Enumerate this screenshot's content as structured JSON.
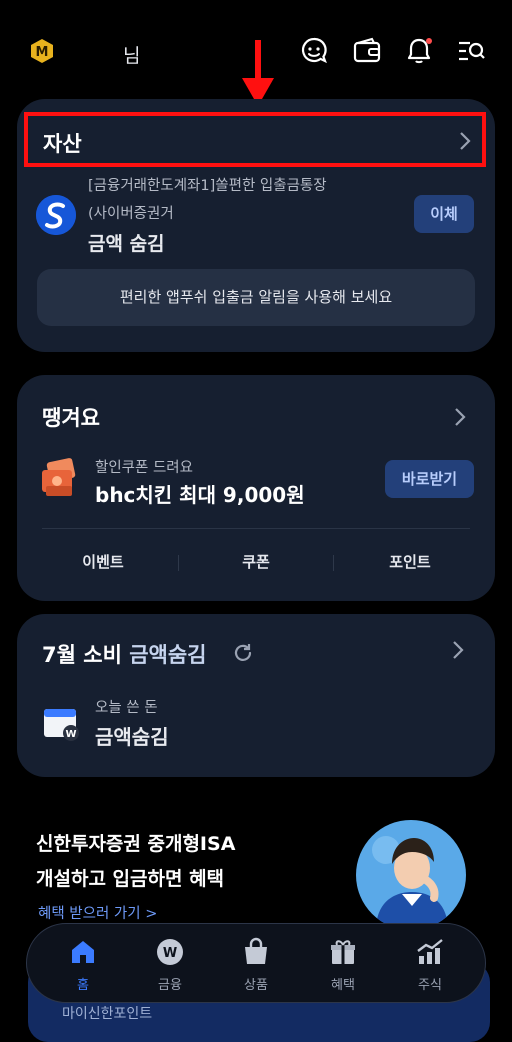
{
  "header": {
    "badge_letter": "M",
    "user_suffix": "님"
  },
  "assets_card": {
    "title": "자산",
    "account_name": "[금융거래한도계좌1]쏠편한 입출금통장",
    "account_bank": "(사이버증권거",
    "amount_hidden": "금액 숨김",
    "transfer_button": "이체",
    "push_banner": "편리한 앱푸쉬 입출금 알림을 사용해 보세요"
  },
  "pull_card": {
    "title": "땡겨요",
    "coupon_sub": "할인쿠폰 드려요",
    "coupon_main": "bhc치킨 최대 9,000원",
    "get_button": "바로받기",
    "tabs": [
      "이벤트",
      "쿠폰",
      "포인트"
    ]
  },
  "spending_card": {
    "title_prefix": "7월 소비",
    "title_accent": "금액숨김",
    "today_label": "오늘 쓴 돈",
    "today_amount": "금액숨김"
  },
  "promo": {
    "line1": "신한투자증권 중개형ISA",
    "line2": "개설하고 입금하면 혜택",
    "link": "혜택 받으러 가기 >"
  },
  "under_card_text": "마이신한포인트",
  "bottom_nav": [
    {
      "label": "홈",
      "icon": "home-icon",
      "active": true
    },
    {
      "label": "금융",
      "icon": "won-coin-icon",
      "active": false
    },
    {
      "label": "상품",
      "icon": "shopping-bag-icon",
      "active": false
    },
    {
      "label": "혜택",
      "icon": "gift-icon",
      "active": false
    },
    {
      "label": "주식",
      "icon": "stock-chart-icon",
      "active": false
    }
  ],
  "colors": {
    "background": "#000000",
    "card": "#161f30",
    "accent_blue": "#3b7bff",
    "highlight_red": "#ff1010"
  }
}
